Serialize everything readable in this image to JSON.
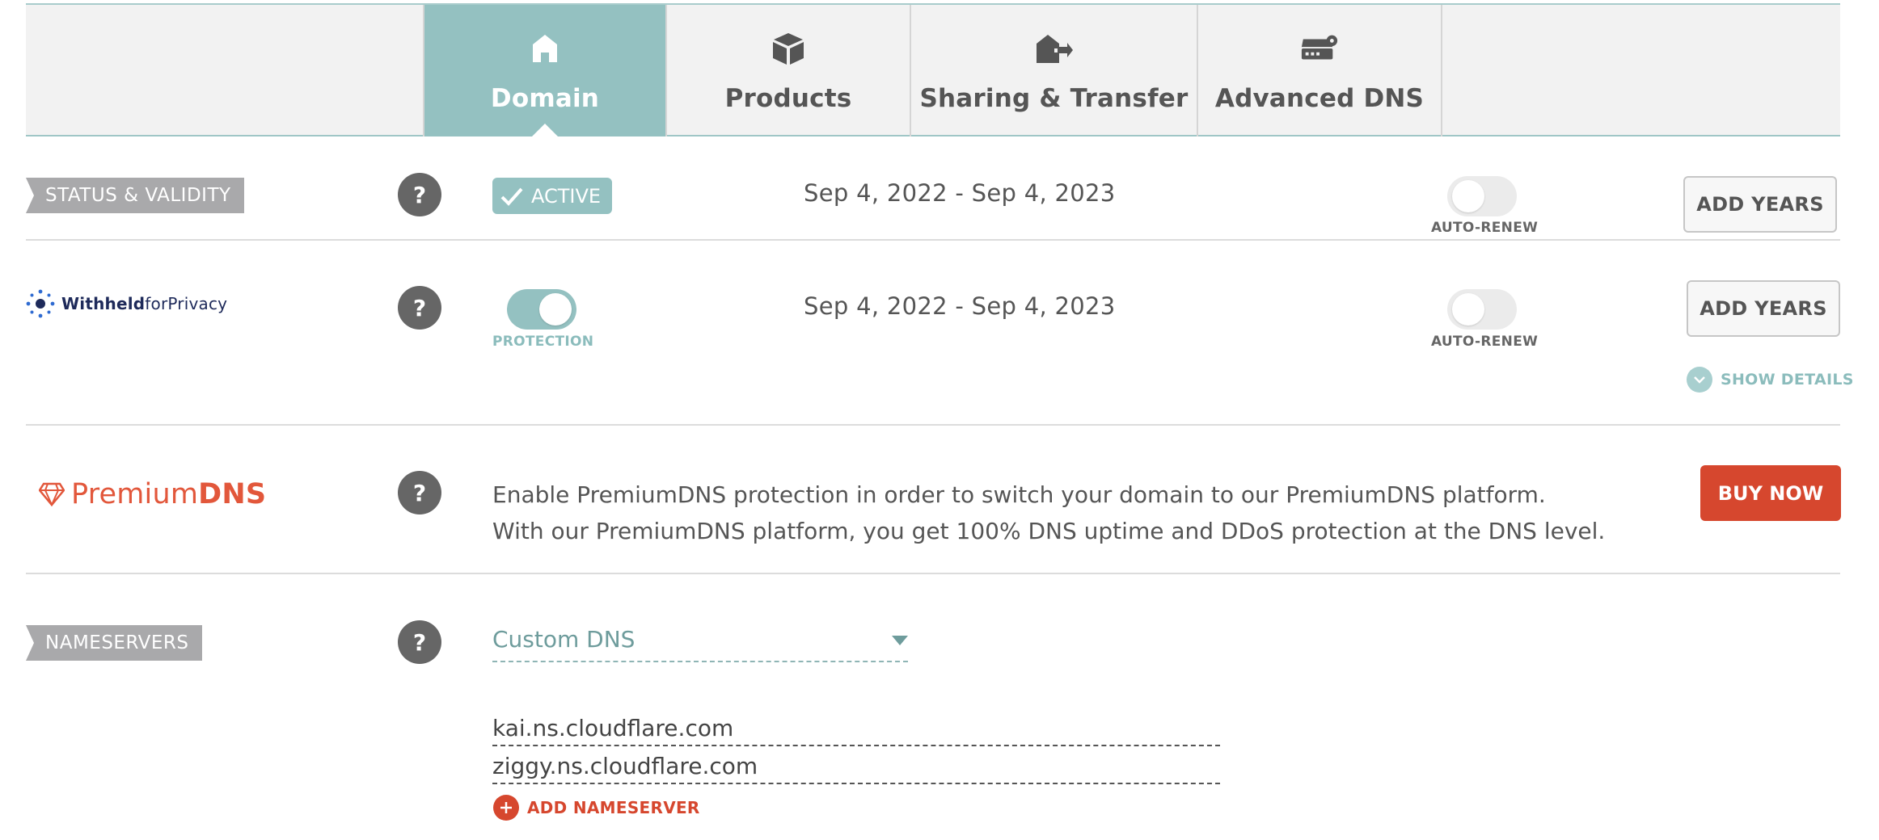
{
  "tabs": [
    {
      "label": "Domain",
      "icon": "home-icon",
      "active": true
    },
    {
      "label": "Products",
      "icon": "box-icon",
      "active": false
    },
    {
      "label": "Sharing & Transfer",
      "icon": "house-transfer-icon",
      "active": false
    },
    {
      "label": "Advanced DNS",
      "icon": "server-gear-icon",
      "active": false
    }
  ],
  "status": {
    "tag": "STATUS & VALIDITY",
    "badge": "ACTIVE",
    "dates": "Sep 4, 2022 - Sep 4, 2023",
    "autorenew_label": "AUTO-RENEW",
    "autorenew_on": false,
    "add_years": "ADD YEARS"
  },
  "privacy": {
    "logo_bold": "Withheld",
    "logo_rest": "forPrivacy",
    "protection_label": "PROTECTION",
    "protection_on": true,
    "dates": "Sep 4, 2022 - Sep 4, 2023",
    "autorenew_label": "AUTO-RENEW",
    "autorenew_on": false,
    "add_years": "ADD YEARS",
    "show_details": "SHOW DETAILS"
  },
  "premiumdns": {
    "logo_regular": "Premium",
    "logo_bold": "DNS",
    "line1": "Enable PremiumDNS protection in order to switch your domain to our PremiumDNS platform.",
    "line2": "With our PremiumDNS platform, you get 100% DNS uptime and DDoS protection at the DNS level.",
    "buy_now": "BUY NOW"
  },
  "nameservers": {
    "tag": "NAMESERVERS",
    "selected": "Custom DNS",
    "entries": [
      "kai.ns.cloudflare.com",
      "ziggy.ns.cloudflare.com"
    ],
    "add_label": "ADD NAMESERVER"
  },
  "help_glyph": "?",
  "colors": {
    "teal": "#94c1c1",
    "grey_tag": "#a9a9ab",
    "red": "#d6472e",
    "navy": "#1e2a5a"
  }
}
